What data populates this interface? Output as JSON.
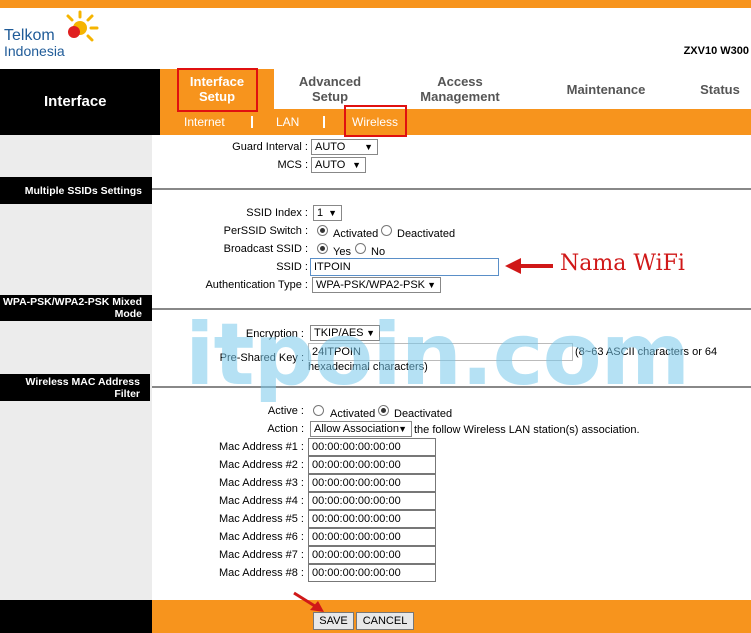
{
  "brand": {
    "name_line1": "Telkom",
    "name_line2": "Indonesia",
    "model": "ZXV10 W300"
  },
  "left_title": "Interface",
  "nav": [
    "Interface Setup",
    "Advanced Setup",
    "Access Management",
    "Maintenance",
    "Status"
  ],
  "subnav": [
    "Internet",
    "LAN",
    "Wireless"
  ],
  "sections": {
    "multi_ssid": "Multiple SSIDs Settings",
    "wpa": "WPA-PSK/WPA2-PSK Mixed Mode",
    "mac_filter": "Wireless MAC Address Filter"
  },
  "fields": {
    "guard_interval": {
      "label": "Guard Interval :",
      "value": "AUTO"
    },
    "mcs": {
      "label": "MCS :",
      "value": "AUTO"
    },
    "ssid_index": {
      "label": "SSID Index :",
      "value": "1"
    },
    "perssid_switch": {
      "label": "PerSSID Switch :",
      "opt1": "Activated",
      "opt2": "Deactivated",
      "selected": "Activated"
    },
    "broadcast_ssid": {
      "label": "Broadcast SSID :",
      "opt1": "Yes",
      "opt2": "No",
      "selected": "Yes"
    },
    "ssid": {
      "label": "SSID :",
      "value": "ITPOIN"
    },
    "auth_type": {
      "label": "Authentication Type :",
      "value": "WPA-PSK/WPA2-PSK"
    },
    "encryption": {
      "label": "Encryption :",
      "value": "TKIP/AES"
    },
    "psk": {
      "label": "Pre-Shared Key :",
      "value": "24ITPOIN",
      "hint": "(8~63 ASCII characters or 64",
      "hint2": "hexadecimal characters)"
    },
    "mac_active": {
      "label": "Active :",
      "opt1": "Activated",
      "opt2": "Deactivated",
      "selected": "Deactivated"
    },
    "action": {
      "label": "Action :",
      "value": "Allow Association",
      "suffix": "the follow Wireless LAN station(s) association."
    }
  },
  "mac_addresses": [
    {
      "label": "Mac Address #1 :",
      "value": "00:00:00:00:00:00"
    },
    {
      "label": "Mac Address #2 :",
      "value": "00:00:00:00:00:00"
    },
    {
      "label": "Mac Address #3 :",
      "value": "00:00:00:00:00:00"
    },
    {
      "label": "Mac Address #4 :",
      "value": "00:00:00:00:00:00"
    },
    {
      "label": "Mac Address #5 :",
      "value": "00:00:00:00:00:00"
    },
    {
      "label": "Mac Address #6 :",
      "value": "00:00:00:00:00:00"
    },
    {
      "label": "Mac Address #7 :",
      "value": "00:00:00:00:00:00"
    },
    {
      "label": "Mac Address #8 :",
      "value": "00:00:00:00:00:00"
    }
  ],
  "buttons": {
    "save": "SAVE",
    "cancel": "CANCEL"
  },
  "annotation": "Nama WiFi",
  "watermark": "itpoin.com",
  "colors": {
    "accent": "#f7941d",
    "highlight": "#e01010"
  }
}
